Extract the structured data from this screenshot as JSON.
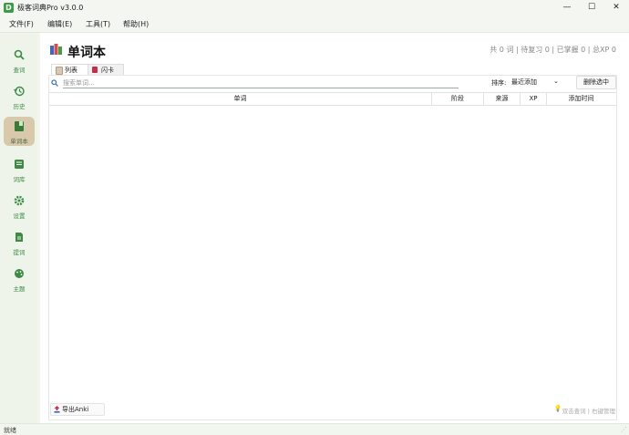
{
  "window": {
    "title": "极客词典Pro v3.0.0",
    "icon": "D"
  },
  "menu": [
    "文件(F)",
    "编辑(E)",
    "工具(T)",
    "帮助(H)"
  ],
  "sidebar": [
    {
      "label": "查词",
      "icon": "search-icon"
    },
    {
      "label": "历史",
      "icon": "history-icon"
    },
    {
      "label": "单词本",
      "icon": "book-icon",
      "active": true
    },
    {
      "label": "词库",
      "icon": "library-icon"
    },
    {
      "label": "设置",
      "icon": "gear-icon"
    },
    {
      "label": "提词",
      "icon": "document-icon"
    },
    {
      "label": "主题",
      "icon": "palette-icon"
    }
  ],
  "page": {
    "title": "单词本",
    "stats": "共 0 词 | 待复习 0 | 已掌握 0 | 总XP 0",
    "tabs": [
      {
        "label": "列表",
        "active": true
      },
      {
        "label": "闪卡"
      }
    ]
  },
  "toolbar": {
    "search_placeholder": "搜索单词...",
    "sort_label": "排序:",
    "sort_value": "最近添加",
    "delete_label": "删除选中"
  },
  "table": {
    "columns": [
      "单词",
      "阶段",
      "来源",
      "XP",
      "添加时间"
    ],
    "rows": []
  },
  "footer": {
    "export_label": "导出Anki",
    "hint": "双击查词 | 右键管理"
  },
  "status": "就绪",
  "colors": {
    "accent": "#3d8a45",
    "active_nav": "#d8c9ad"
  }
}
